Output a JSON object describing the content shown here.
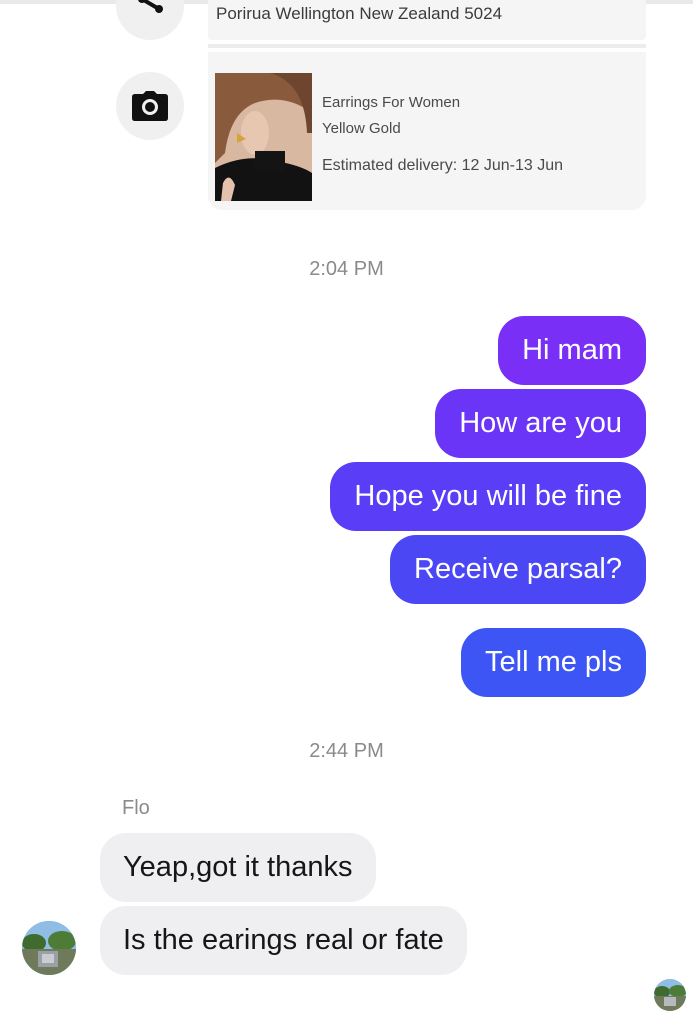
{
  "order": {
    "address": "Porirua Wellington New Zealand 5024",
    "product_name": "Earrings For Women",
    "product_variant": "Yellow Gold",
    "delivery": "Estimated delivery: 12 Jun-13 Jun"
  },
  "icons": {
    "share": "share-icon",
    "camera": "camera-icon"
  },
  "colors": {
    "bubble_gradient_top": "#7b2ff7",
    "bubble_gradient_bottom": "#3a5cf5",
    "incoming_bubble": "#efeff1",
    "timestamp": "#8a8a8a"
  },
  "conversation": {
    "timestamp_1": "2:04 PM",
    "outgoing": [
      {
        "text": "Hi mam"
      },
      {
        "text": "How are you"
      },
      {
        "text": "Hope you will be fine"
      },
      {
        "text": "Receive parsal?"
      },
      {
        "text": "Tell me pls"
      }
    ],
    "timestamp_2": "2:44 PM",
    "sender_name": "Flo",
    "incoming": [
      {
        "text": "Yeap,got it thanks"
      },
      {
        "text": "Is the earings real or fate"
      }
    ]
  }
}
